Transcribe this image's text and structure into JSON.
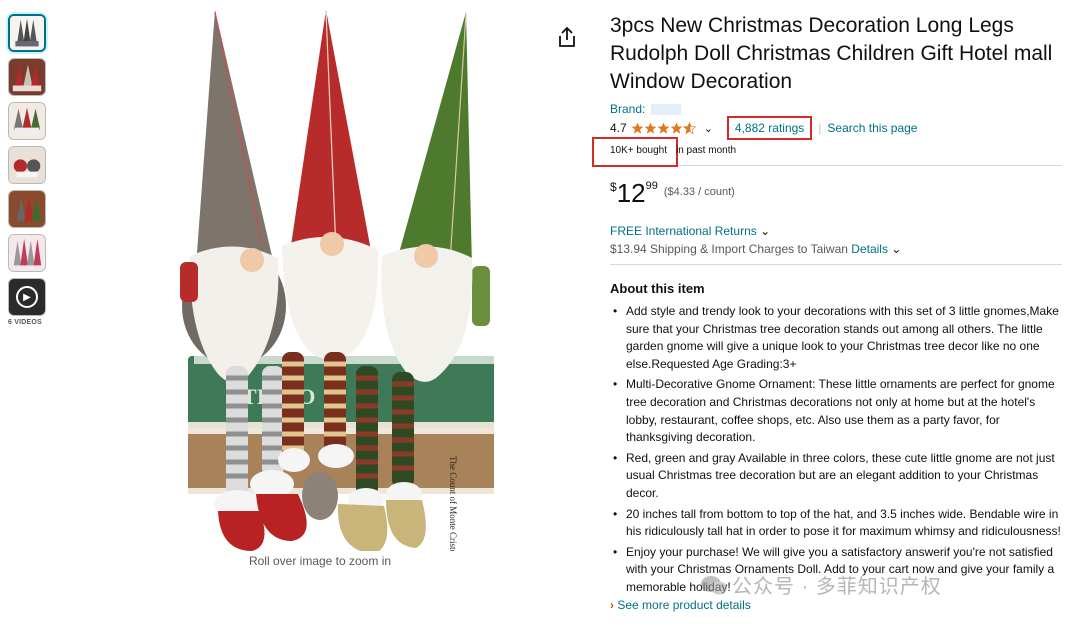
{
  "thumbnails": {
    "count": 7,
    "videos_label": "6 VIDEOS"
  },
  "image": {
    "zoom_hint": "Roll over image to zoom in",
    "book_text_1": "TIQUO",
    "book_text_2": "The Count of Monte Cristo"
  },
  "product": {
    "title": "3pcs New Christmas Decoration Long Legs Rudolph Doll Christmas Children Gift Hotel mall Window Decoration",
    "brand_label": "Brand: ",
    "rating": "4.7",
    "rating_stars": 4.7,
    "ratings_count": "4,882 ratings",
    "separator": "|",
    "search_page": "Search this page",
    "bought_bold": "10K+ bought",
    "bought_rest": "in past month",
    "price": {
      "currency": "$",
      "whole": "12",
      "fraction": "99",
      "unit": "($4.33 / count)"
    },
    "free_returns": "FREE International Returns",
    "shipping_text": "$13.94 Shipping & Import Charges to Taiwan",
    "shipping_details": "Details"
  },
  "about": {
    "title": "About this item",
    "bullets": [
      "Add style and trendy look to your decorations with this set of 3 little gnomes,Make sure that your Christmas tree decoration stands out among all others. The little garden gnome will give a unique look to your Christmas tree decor like no one else.Requested Age Grading:3+",
      "Multi-Decorative Gnome Ornament: These little ornaments are perfect for gnome tree decoration and Christmas decorations not only at home but at the hotel's lobby, restaurant, coffee shops, etc. Also use them as a party favor, for thanksgiving decoration.",
      "Red, green and gray Available in three colors, these cute little gnome are not just usual Christmas tree decoration but are an elegant addition to your Christmas decor.",
      "20 inches tall from bottom to top of the hat, and 3.5 inches wide. Bendable wire in his ridiculously tall hat in order to pose it for maximum whimsy and ridiculousness!",
      "Enjoy your purchase! We will give you a satisfactory answerif you're not satisfied with your Christmas Ornaments Doll. Add to your cart now and give your family a memorable holiday!"
    ],
    "see_more": "See more product details"
  },
  "watermark": {
    "text": "公众号 · 多菲知识产权"
  },
  "colors": {
    "link": "#007185",
    "highlight_box": "#d32a2a",
    "star": "#de7921"
  }
}
